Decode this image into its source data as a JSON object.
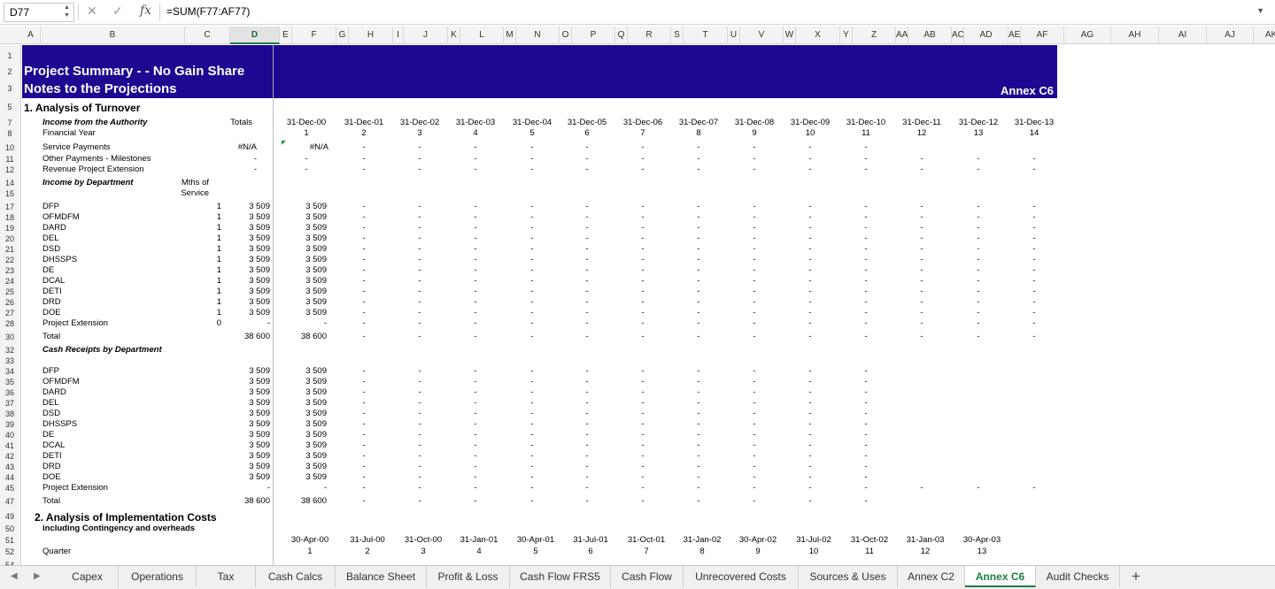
{
  "formula_bar": {
    "cell_ref": "D77",
    "fx_label": "fx",
    "formula": "=SUM(F77:AF77)"
  },
  "column_headers": [
    "A",
    "B",
    "C",
    "D",
    "E",
    "F",
    "G",
    "H",
    "I",
    "J",
    "K",
    "L",
    "M",
    "N",
    "O",
    "P",
    "Q",
    "R",
    "S",
    "T",
    "U",
    "V",
    "W",
    "X",
    "Y",
    "Z",
    "AA",
    "AB",
    "AC",
    "AD",
    "AE",
    "AF",
    "AG",
    "AH",
    "AI",
    "AJ",
    "AK"
  ],
  "active_column": "D",
  "row_numbers": [
    {
      "n": "1",
      "row": 1
    },
    {
      "n": "2",
      "row": 2
    },
    {
      "n": "3",
      "row": 3
    },
    {
      "n": "5",
      "row": 5
    },
    {
      "n": "7",
      "row": 7
    },
    {
      "n": "8",
      "row": 8
    },
    {
      "n": "10",
      "row": 10
    },
    {
      "n": "11",
      "row": 11
    },
    {
      "n": "12",
      "row": 12
    },
    {
      "n": "14",
      "row": 14
    },
    {
      "n": "15",
      "row": 15
    },
    {
      "n": "17",
      "row": 17
    },
    {
      "n": "18",
      "row": 18
    },
    {
      "n": "19",
      "row": 19
    },
    {
      "n": "20",
      "row": 20
    },
    {
      "n": "21",
      "row": 21
    },
    {
      "n": "22",
      "row": 22
    },
    {
      "n": "23",
      "row": 23
    },
    {
      "n": "24",
      "row": 24
    },
    {
      "n": "25",
      "row": 25
    },
    {
      "n": "26",
      "row": 26
    },
    {
      "n": "27",
      "row": 27
    },
    {
      "n": "28",
      "row": 28
    },
    {
      "n": "30",
      "row": 30
    },
    {
      "n": "32",
      "row": 32
    },
    {
      "n": "33",
      "row": 33
    },
    {
      "n": "34",
      "row": 34
    },
    {
      "n": "35",
      "row": 35
    },
    {
      "n": "36",
      "row": 36
    },
    {
      "n": "37",
      "row": 37
    },
    {
      "n": "38",
      "row": 38
    },
    {
      "n": "39",
      "row": 39
    },
    {
      "n": "40",
      "row": 40
    },
    {
      "n": "41",
      "row": 41
    },
    {
      "n": "42",
      "row": 42
    },
    {
      "n": "43",
      "row": 43
    },
    {
      "n": "44",
      "row": 44
    },
    {
      "n": "45",
      "row": 45
    },
    {
      "n": "47",
      "row": 47
    },
    {
      "n": "49",
      "row": 49
    },
    {
      "n": "50",
      "row": 50
    },
    {
      "n": "51",
      "row": 51
    },
    {
      "n": "52",
      "row": 52
    },
    {
      "n": "54",
      "row": 54
    }
  ],
  "banner": {
    "title1": "Project Summary -  - No Gain Share",
    "title2": "Notes to the Projections",
    "annex": "Annex C6"
  },
  "turnover": {
    "heading": "1. Analysis of Turnover",
    "income_from_authority": "Income from the Authority",
    "totals_label": "Totals",
    "financial_year": "Financial Year",
    "dates": [
      "31-Dec-00",
      "31-Dec-01",
      "31-Dec-02",
      "31-Dec-03",
      "31-Dec-04",
      "31-Dec-05",
      "31-Dec-06",
      "31-Dec-07",
      "31-Dec-08",
      "31-Dec-09",
      "31-Dec-10",
      "31-Dec-11",
      "31-Dec-12",
      "31-Dec-13"
    ],
    "years": [
      "1",
      "2",
      "3",
      "4",
      "5",
      "6",
      "7",
      "8",
      "9",
      "10",
      "11",
      "12",
      "13",
      "14"
    ],
    "service_payments": {
      "label": "Service Payments",
      "total": "#N/A",
      "f": "#N/A"
    },
    "other_payments": {
      "label": "Other Payments - Milestones",
      "total": "-"
    },
    "revenue_ext": {
      "label": "Revenue Project Extension",
      "total": "-"
    },
    "income_by_dept": "Income by Department",
    "mths_of": "Mths of",
    "service": "Service",
    "departments": [
      {
        "name": "DFP",
        "m": "1",
        "total": "3 509",
        "f": "3 509"
      },
      {
        "name": "OFMDFM",
        "m": "1",
        "total": "3 509",
        "f": "3 509"
      },
      {
        "name": "DARD",
        "m": "1",
        "total": "3 509",
        "f": "3 509"
      },
      {
        "name": "DEL",
        "m": "1",
        "total": "3 509",
        "f": "3 509"
      },
      {
        "name": "DSD",
        "m": "1",
        "total": "3 509",
        "f": "3 509"
      },
      {
        "name": "DHSSPS",
        "m": "1",
        "total": "3 509",
        "f": "3 509"
      },
      {
        "name": "DE",
        "m": "1",
        "total": "3 509",
        "f": "3 509"
      },
      {
        "name": "DCAL",
        "m": "1",
        "total": "3 509",
        "f": "3 509"
      },
      {
        "name": "DETI",
        "m": "1",
        "total": "3 509",
        "f": "3 509"
      },
      {
        "name": "DRD",
        "m": "1",
        "total": "3 509",
        "f": "3 509"
      },
      {
        "name": "DOE",
        "m": "1",
        "total": "3 509",
        "f": "3 509"
      },
      {
        "name": "Project Extension",
        "m": "0",
        "total": "-",
        "f": "-"
      }
    ],
    "total": {
      "label": "Total",
      "total": "38 600",
      "f": "38 600"
    },
    "cash_receipts": "Cash Receipts by Department",
    "cash_depts": [
      {
        "name": "DFP",
        "total": "3 509",
        "f": "3 509"
      },
      {
        "name": "OFMDFM",
        "total": "3 509",
        "f": "3 509"
      },
      {
        "name": "DARD",
        "total": "3 509",
        "f": "3 509"
      },
      {
        "name": "DEL",
        "total": "3 509",
        "f": "3 509"
      },
      {
        "name": "DSD",
        "total": "3 509",
        "f": "3 509"
      },
      {
        "name": "DHSSPS",
        "total": "3 509",
        "f": "3 509"
      },
      {
        "name": "DE",
        "total": "3 509",
        "f": "3 509"
      },
      {
        "name": "DCAL",
        "total": "3 509",
        "f": "3 509"
      },
      {
        "name": "DETI",
        "total": "3 509",
        "f": "3 509"
      },
      {
        "name": "DRD",
        "total": "3 509",
        "f": "3 509"
      },
      {
        "name": "DOE",
        "total": "3 509",
        "f": "3 509"
      },
      {
        "name": "Project Extension",
        "total": "-",
        "f": "-"
      }
    ],
    "cash_total": {
      "label": "Total",
      "total": "38 600",
      "f": "38 600"
    },
    "dash": "-"
  },
  "implementation": {
    "heading": "2. Analysis of Implementation Costs",
    "subheading": "including Contingency and overheads",
    "dates": [
      "30-Apr-00",
      "31-Jul-00",
      "31-Oct-00",
      "31-Jan-01",
      "30-Apr-01",
      "31-Jul-01",
      "31-Oct-01",
      "31-Jan-02",
      "30-Apr-02",
      "31-Jul-02",
      "31-Oct-02",
      "31-Jan-03",
      "30-Apr-03"
    ],
    "quarters": [
      "1",
      "2",
      "3",
      "4",
      "5",
      "6",
      "7",
      "8",
      "9",
      "10",
      "11",
      "12",
      "13"
    ],
    "quarter_label": "Quarter"
  },
  "sheet_tabs": [
    "Capex",
    "Operations",
    "Tax",
    "Cash Calcs",
    "Balance Sheet",
    "Profit & Loss",
    "Cash Flow FRS5",
    "Cash Flow",
    "Unrecovered Costs",
    "Sources & Uses",
    "Annex C2",
    "Annex C6",
    "Audit Checks"
  ],
  "active_tab": "Annex C6",
  "colors": {
    "banner": "#1e0791",
    "accent": "#1d7d44"
  }
}
